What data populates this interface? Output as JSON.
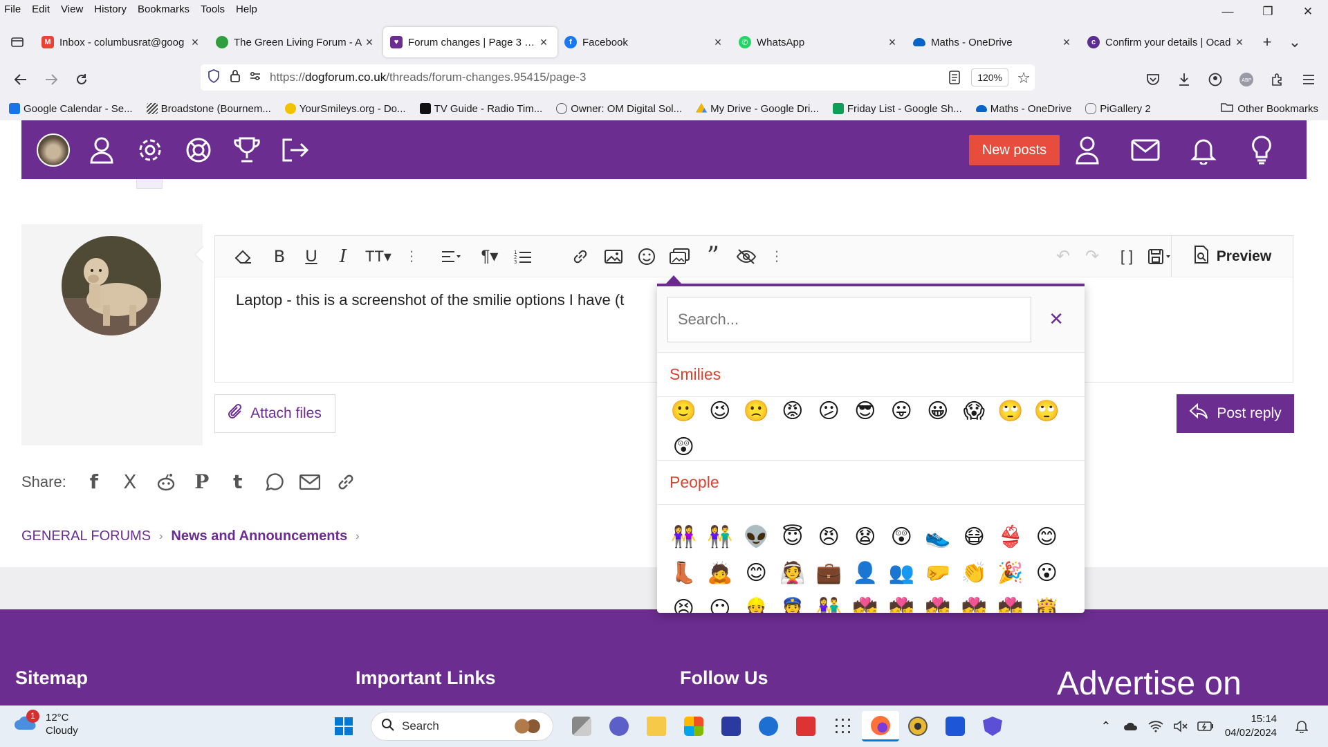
{
  "menubar": {
    "items": [
      "File",
      "Edit",
      "View",
      "History",
      "Bookmarks",
      "Tools",
      "Help"
    ]
  },
  "tabs": [
    {
      "label": "Inbox - columbusrat@goog",
      "icon": "gmail-icon",
      "color": "#ea4335"
    },
    {
      "label": "The Green Living Forum - A",
      "icon": "tree-icon",
      "color": "#2e9e3e"
    },
    {
      "label": "Forum changes | Page 3 | D",
      "icon": "forum-icon",
      "color": "#6b2d90",
      "active": true
    },
    {
      "label": "Facebook",
      "icon": "facebook-icon",
      "color": "#1877f2"
    },
    {
      "label": "WhatsApp",
      "icon": "whatsapp-icon",
      "color": "#25d366"
    },
    {
      "label": "Maths - OneDrive",
      "icon": "onedrive-icon",
      "color": "#0a64c8"
    },
    {
      "label": "Confirm your details | Ocad",
      "icon": "ocado-icon",
      "color": "#5c2d91"
    }
  ],
  "navbar": {
    "url_scheme": "https://",
    "url_host": "dogforum.co.uk",
    "url_path": "/threads/forum-changes.95415/page-3",
    "zoom": "120%"
  },
  "bookmarks": [
    {
      "label": "Google Calendar - Se...",
      "color": "#1a73e8"
    },
    {
      "label": "Broadstone (Bournem...",
      "color": "#555555"
    },
    {
      "label": "YourSmileys.org - Do...",
      "color": "#f2c200"
    },
    {
      "label": "TV Guide - Radio Tim...",
      "color": "#111111"
    },
    {
      "label": "Owner: OM Digital Sol...",
      "color": "#666666"
    },
    {
      "label": "My Drive - Google Dri...",
      "color": "#f4b400"
    },
    {
      "label": "Friday List - Google Sh...",
      "color": "#0f9d58"
    },
    {
      "label": "Maths - OneDrive",
      "color": "#0a64c8"
    },
    {
      "label": "PiGallery 2",
      "color": "#777777"
    }
  ],
  "other_bookmarks": "Other Bookmarks",
  "forum": {
    "new_posts": "New posts",
    "editor_text": "Laptop - this is a screenshot of the smilie options I have (t",
    "preview": "Preview",
    "attach": "Attach files",
    "post_reply": "Post reply",
    "share_label": "Share:",
    "breadcrumb": [
      "GENERAL FORUMS",
      "News and Announcements"
    ],
    "brand_color": "#6b2d90",
    "accent_color": "#e74c3c"
  },
  "emoji_picker": {
    "search_placeholder": "Search...",
    "categories": [
      {
        "name": "Smilies",
        "items": [
          "🙂",
          "😉",
          "🙁",
          "😡",
          "😕",
          "😎",
          "😛",
          "😀",
          "😱",
          "🙄",
          "🙄",
          "😲"
        ]
      },
      {
        "name": "People",
        "items": [
          "👭",
          "👫",
          "👽",
          "😇",
          "😠",
          "😧",
          "😲",
          "👟",
          "😷",
          "👙",
          "😊",
          "👢",
          "🙇",
          "😊",
          "👰",
          "💼",
          "👤",
          "👥",
          "🤛",
          "👏",
          "🎉",
          "😮",
          "😣",
          "😶",
          "👷",
          "👮",
          "👫",
          "💏",
          "💏",
          "💏",
          "💏",
          "💏",
          "👸",
          "😳"
        ]
      }
    ]
  },
  "footer": {
    "sitemap": "Sitemap",
    "important_links": "Important Links",
    "follow_us": "Follow Us",
    "advertise": "Advertise on"
  },
  "taskbar": {
    "temp": "12°C",
    "condition": "Cloudy",
    "notif_count": "1",
    "search": "Search",
    "time": "15:14",
    "date": "04/02/2024"
  }
}
